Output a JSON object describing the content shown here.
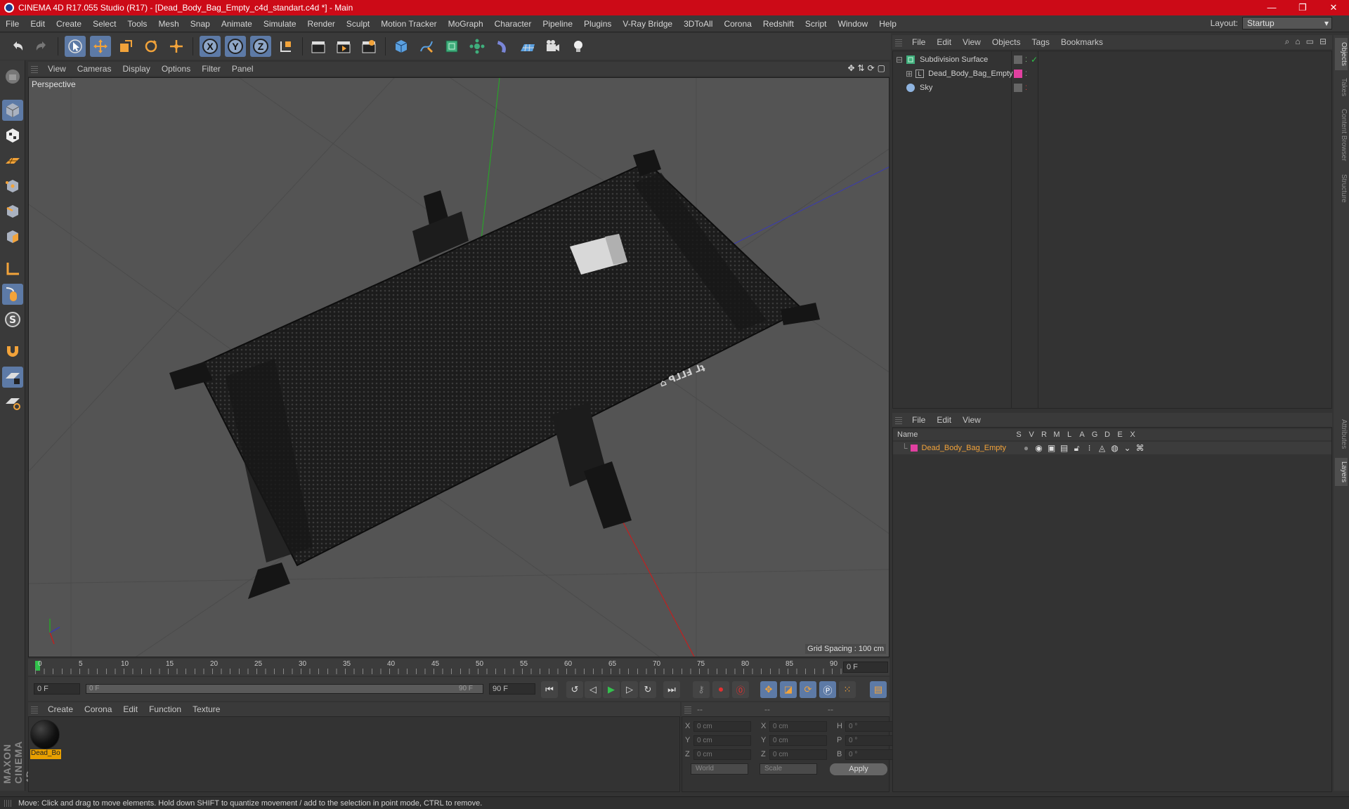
{
  "titlebar": {
    "title": "CINEMA 4D R17.055 Studio (R17) - [Dead_Body_Bag_Empty_c4d_standart.c4d *] - Main",
    "minimize": "—",
    "maximize": "❐",
    "close": "✕"
  },
  "menubar": {
    "items": [
      "File",
      "Edit",
      "Create",
      "Select",
      "Tools",
      "Mesh",
      "Snap",
      "Animate",
      "Simulate",
      "Render",
      "Sculpt",
      "Motion Tracker",
      "MoGraph",
      "Character",
      "Pipeline",
      "Plugins",
      "V-Ray Bridge",
      "3DToAll",
      "Corona",
      "Redshift",
      "Script",
      "Window",
      "Help"
    ],
    "layout_label": "Layout:",
    "layout_value": "Startup"
  },
  "toolbar": {
    "axis_x": "X",
    "axis_y": "Y",
    "axis_z": "Z"
  },
  "viewport": {
    "menu": [
      "View",
      "Cameras",
      "Display",
      "Options",
      "Filter",
      "Panel"
    ],
    "label": "Perspective",
    "grid_spacing": "Grid Spacing : 100 cm"
  },
  "timeline": {
    "ticks": [
      "0",
      "5",
      "10",
      "15",
      "20",
      "25",
      "30",
      "35",
      "40",
      "45",
      "50",
      "55",
      "60",
      "65",
      "70",
      "75",
      "80",
      "85",
      "90"
    ],
    "current_frame": "0 F",
    "start_field": "0 F",
    "slider_start": "0 F",
    "slider_end": "90 F",
    "end_field": "90 F"
  },
  "material_manager": {
    "menu": [
      "Create",
      "Corona",
      "Edit",
      "Function",
      "Texture"
    ],
    "material_label": "Dead_Bo"
  },
  "coordinates": {
    "header": [
      "--",
      "--",
      "--"
    ],
    "rows": [
      {
        "a": "X",
        "av": "0 cm",
        "b": "X",
        "bv": "0 cm",
        "c": "H",
        "cv": "0 °"
      },
      {
        "a": "Y",
        "av": "0 cm",
        "b": "Y",
        "bv": "0 cm",
        "c": "P",
        "cv": "0 °"
      },
      {
        "a": "Z",
        "av": "0 cm",
        "b": "Z",
        "bv": "0 cm",
        "c": "B",
        "cv": "0 °"
      }
    ],
    "mode": "World",
    "scale": "Scale",
    "apply": "Apply"
  },
  "object_manager": {
    "menu": [
      "File",
      "Edit",
      "View",
      "Objects",
      "Tags",
      "Bookmarks"
    ],
    "objects": [
      {
        "name": "Subdivision Surface"
      },
      {
        "name": "Dead_Body_Bag_Empty"
      },
      {
        "name": "Sky"
      }
    ]
  },
  "layer_manager": {
    "menu": [
      "File",
      "Edit",
      "View"
    ],
    "header_name": "Name",
    "columns": [
      "S",
      "V",
      "R",
      "M",
      "L",
      "A",
      "G",
      "D",
      "E",
      "X"
    ],
    "layer_name": "Dead_Body_Bag_Empty",
    "layer_color": "#e040a0"
  },
  "right_tabs": [
    "Objects",
    "Takes",
    "Content Browser",
    "Structure",
    "Attributes",
    "Layers"
  ],
  "status": "Move: Click and drag to move elements. Hold down SHIFT to quantize movement / add to the selection in point mode, CTRL to remove.",
  "colors": {
    "title_red": "#cc0a17",
    "accent_blue": "#5d7aa6",
    "layer_highlight": "#e8a000"
  }
}
